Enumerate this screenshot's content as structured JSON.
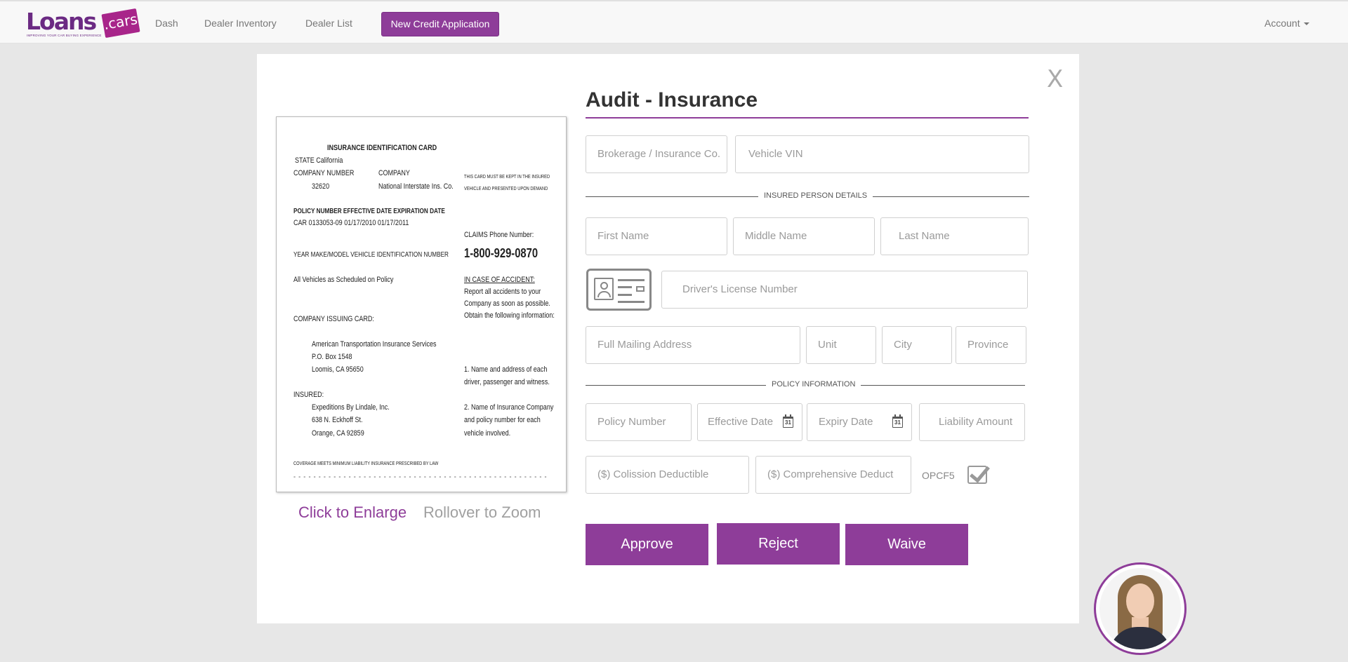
{
  "navbar": {
    "logo_word": "Loans",
    "logo_tag": ".cars",
    "logo_tagline": "IMPROVING YOUR CAR BUYING EXPERIENCE",
    "links": [
      "Dash",
      "Dealer Inventory",
      "Dealer List"
    ],
    "primary_button": "New Credit Application",
    "account": "Account"
  },
  "modal": {
    "close": "X",
    "title": "Audit - Insurance",
    "preview": {
      "enlarge": "Click to Enlarge",
      "zoom": "Rollover to Zoom",
      "card": {
        "heading": "INSURANCE IDENTIFICATION CARD",
        "state": "STATE   California",
        "company_number_label": "COMPANY NUMBER",
        "company_label": "COMPANY",
        "company_number": "32620",
        "company_name": "National Interstate Ins. Co.",
        "notice_1": "THIS CARD MUST BE KEPT IN THE INSURED",
        "notice_2": "VEHICLE AND PRESENTED UPON DEMAND",
        "policy_labels": "POLICY NUMBER    EFFECTIVE DATE    EXPIRATION DATE",
        "policy_values": "CAR 0133053-09    01/17/2010        01/17/2011",
        "claims_label": "CLAIMS Phone Number:",
        "claims_phone": "1-800-929-0870",
        "vehicle_labels": "YEAR   MAKE/MODEL   VEHICLE IDENTIFICATION NUMBER",
        "vehicles": "All Vehicles as Scheduled on Policy",
        "accident_heading": "IN CASE OF ACCIDENT:",
        "accident_1": "Report all accidents to your",
        "accident_2": "Company as soon as possible.",
        "accident_3": "Obtain the following information:",
        "issuing_label": "COMPANY ISSUING CARD:",
        "issuer_1": "American Transportation Insurance Services",
        "issuer_2": "P.O. Box 1548",
        "issuer_3": "Loomis, CA  95650",
        "info_1a": "1. Name and address of each",
        "info_1b": "driver, passenger and witness.",
        "insured_label": "INSURED:",
        "insured_1": "Expeditions By Lindale, Inc.",
        "insured_2": "638 N. Eckhoff St.",
        "insured_3": "Orange, CA  92859",
        "info_2a": "2. Name of Insurance Company",
        "info_2b": "and policy number for each",
        "info_2c": "vehicle involved.",
        "coverage": "COVERAGE MEETS MINIMUM LIABILITY INSURANCE PRESCRIBED BY LAW",
        "cut_line": "- - - - - - - - - - - - - - - - - - - - - - - - - - - - - - - - - - - - - - - - - - - - - - - - - - -"
      }
    },
    "form": {
      "brokerage": "Brokerage / Insurance Co.",
      "vin": "Vehicle VIN",
      "insured_section": "INSURED PERSON DETAILS",
      "first_name": "First Name",
      "middle_name": "Middle Name",
      "last_name": "Last Name",
      "license": "Driver's License Number",
      "address": "Full Mailing Address",
      "unit": "Unit",
      "city": "City",
      "province": "Province",
      "policy_section": "POLICY INFORMATION",
      "policy_number": "Policy Number",
      "effective_date": "Effective Date",
      "expiry_date": "Expiry Date",
      "calendar_day": "31",
      "liability": "Liability Amount",
      "collision": "($) Colission Deductible",
      "comprehensive": "($) Comprehensive Deduct",
      "opcf": "OPCF5"
    },
    "buttons": {
      "approve": "Approve",
      "reject": "Reject",
      "waive": "Waive"
    }
  },
  "colors": {
    "brand": "#8e3d99",
    "background": "#e7e7e7"
  },
  "icons": [
    "calendar-icon",
    "id-card-icon",
    "checkbox-check-icon",
    "close-icon",
    "caret-down-icon"
  ]
}
